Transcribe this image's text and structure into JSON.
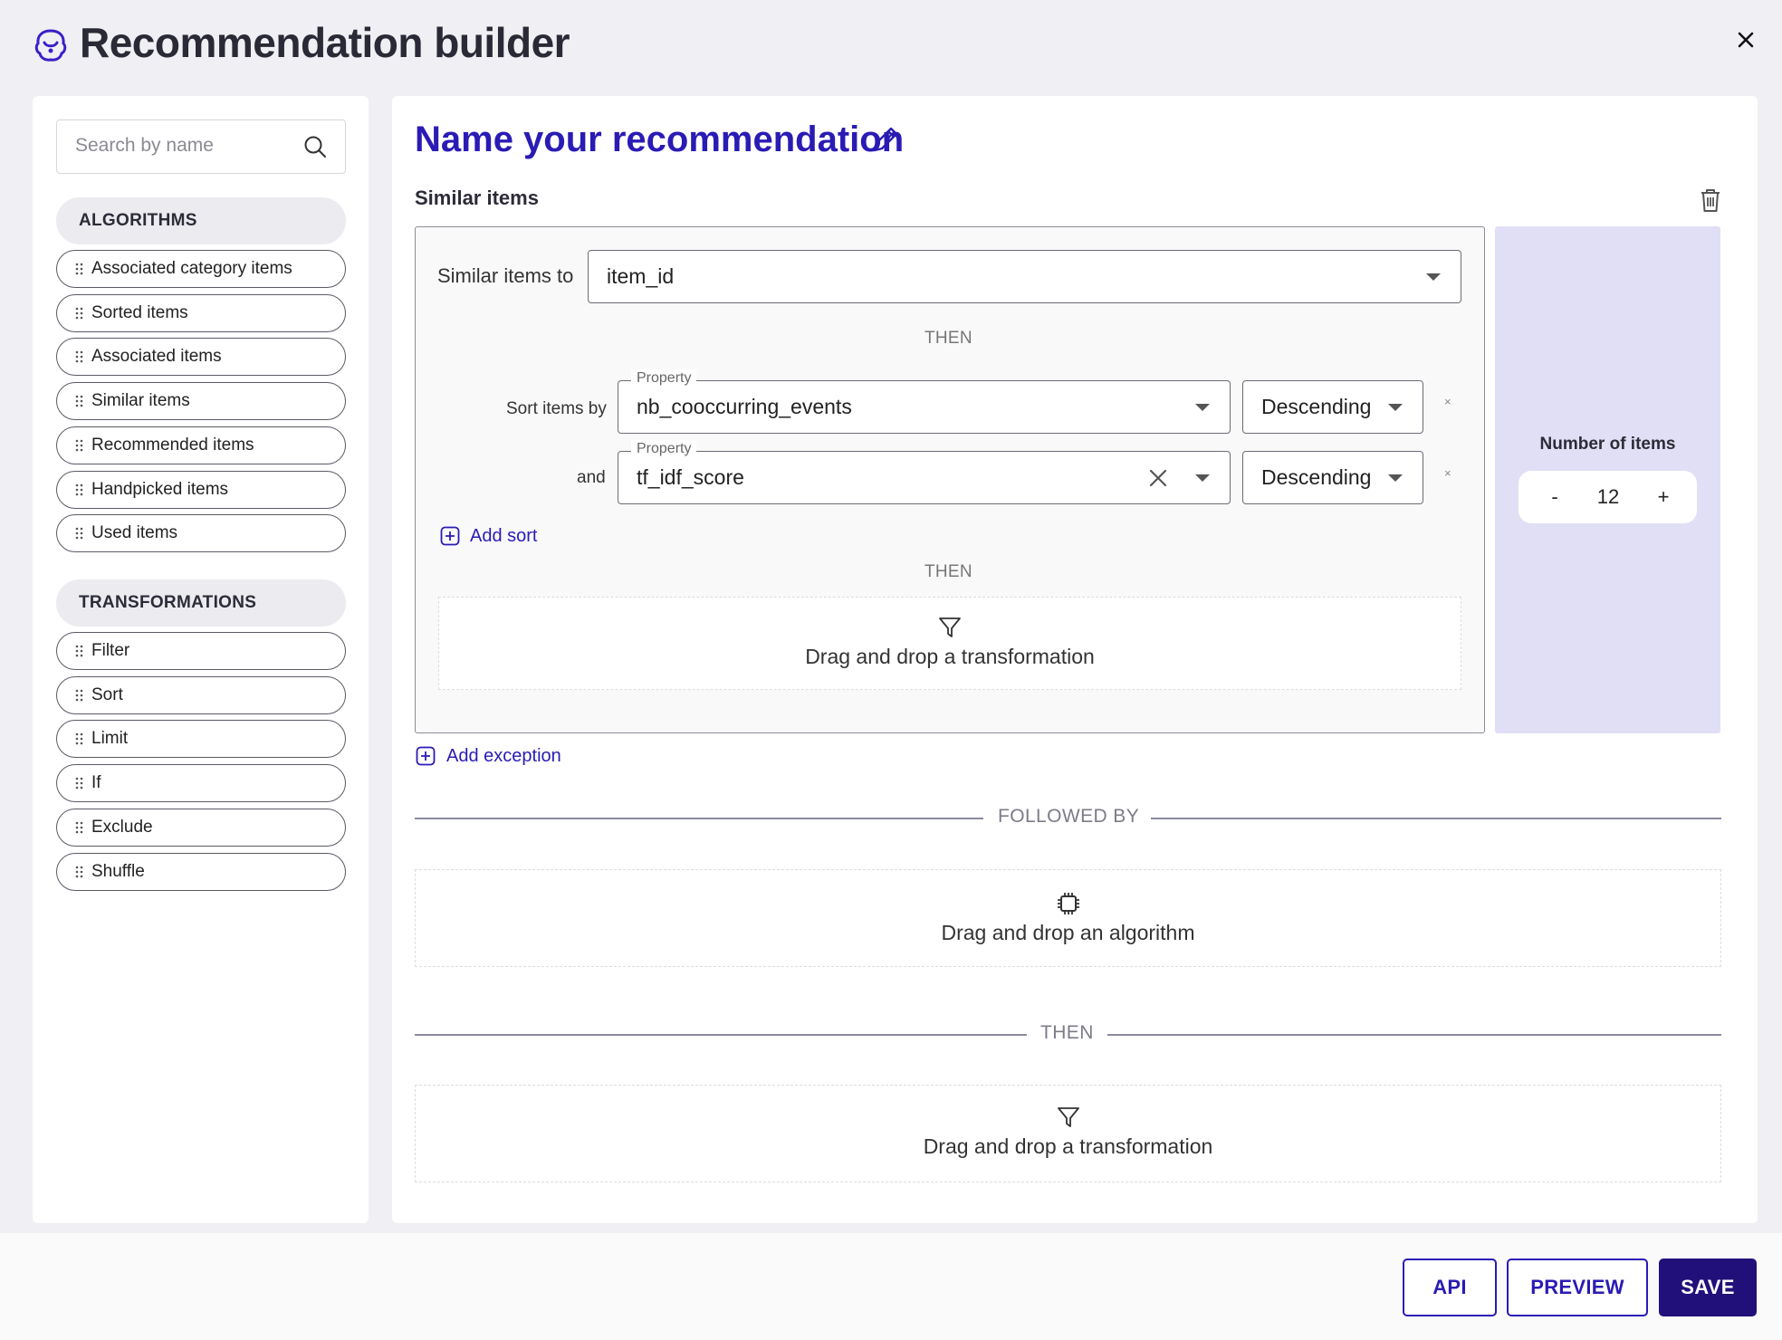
{
  "header": {
    "title": "Recommendation builder",
    "logo_icon": "brain-icon",
    "close_icon": "close-icon"
  },
  "sidebar": {
    "search_placeholder": "Search by name",
    "algorithms_heading": "ALGORITHMS",
    "algorithms": [
      "Associated category items",
      "Sorted items",
      "Associated items",
      "Similar items",
      "Recommended items",
      "Handpicked items",
      "Used items"
    ],
    "transformations_heading": "TRANSFORMATIONS",
    "transformations": [
      "Filter",
      "Sort",
      "Limit",
      "If",
      "Exclude",
      "Shuffle"
    ]
  },
  "main": {
    "recommendation_name": "Name your recommendation",
    "block": {
      "title": "Similar items",
      "similar_to_label": "Similar items to",
      "similar_to_value": "item_id",
      "then_1": "THEN",
      "sort_by_label": "Sort items by",
      "and_label": "and",
      "sorts": [
        {
          "property_label": "Property",
          "property": "nb_cooccurring_events",
          "order": "Descending"
        },
        {
          "property_label": "Property",
          "property": "tf_idf_score",
          "order": "Descending"
        }
      ],
      "remove_label": "×",
      "add_sort": "Add sort",
      "then_2": "THEN",
      "dropzone_transformation": "Drag and drop a transformation",
      "number_of_items_label": "Number of items",
      "number_of_items": "12",
      "minus": "-",
      "plus": "+"
    },
    "add_exception": "Add exception",
    "followed_by": "FOLLOWED BY",
    "dropzone_algorithm": "Drag and drop an algorithm",
    "then_3": "THEN",
    "dropzone_transformation_2": "Drag and drop a transformation"
  },
  "footer": {
    "api": "API",
    "preview": "PREVIEW",
    "save": "SAVE"
  },
  "colors": {
    "accent": "#2a1bb5",
    "save_bg": "#22107a",
    "panel_bg": "#e1dff5",
    "page_bg": "#efeff4"
  }
}
